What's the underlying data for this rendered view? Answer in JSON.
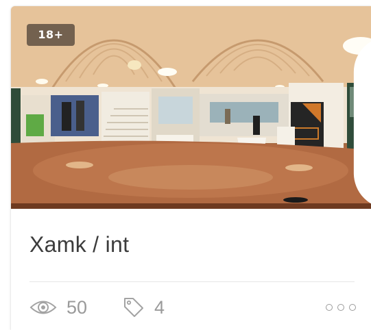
{
  "card": {
    "badge": "18+",
    "title": "Xamk / int",
    "views": "50",
    "tags": "4",
    "icons": {
      "vr": "vr-headset-icon",
      "views": "eye-icon",
      "tags": "tag-icon",
      "more": "more-dots-icon"
    }
  },
  "colors": {
    "title_text": "#3c3c3c",
    "meta_text": "#9a9a9a",
    "badge_bg": "#463c32"
  }
}
